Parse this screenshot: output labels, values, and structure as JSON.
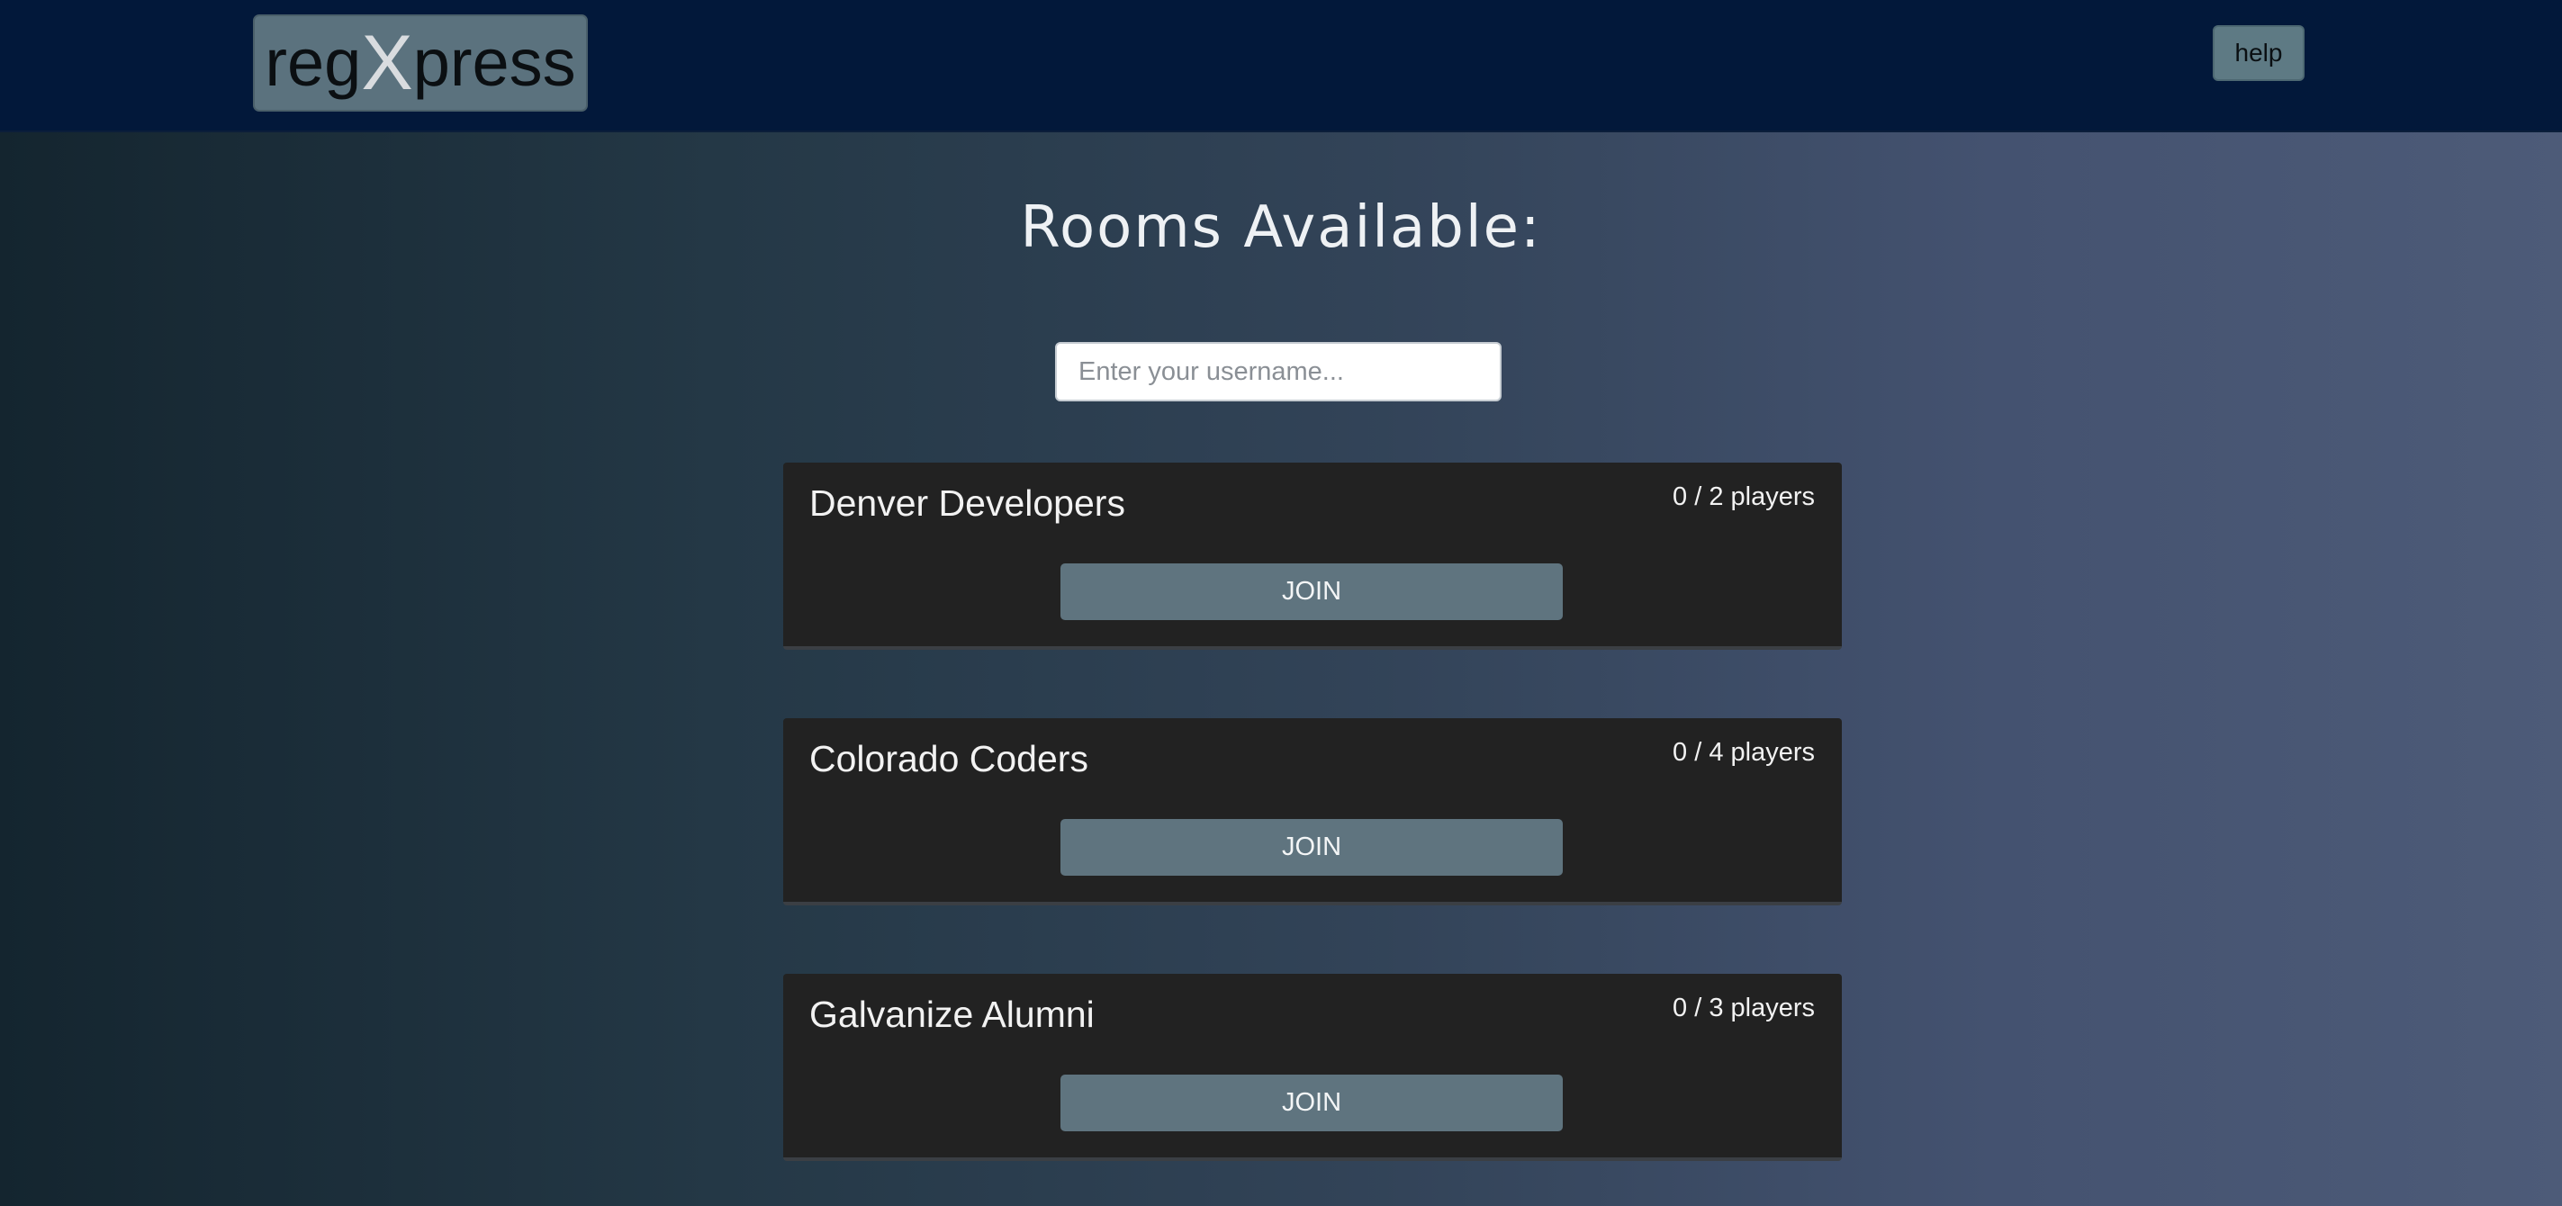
{
  "header": {
    "logo_prefix": "reg",
    "logo_x": "X",
    "logo_suffix": "press",
    "help_label": "help"
  },
  "main": {
    "title": "Rooms Available:",
    "username_placeholder": "Enter your username...",
    "rooms": [
      {
        "name": "Denver Developers",
        "players": "0 / 2 players",
        "join_label": "JOIN"
      },
      {
        "name": "Colorado Coders",
        "players": "0 / 4 players",
        "join_label": "JOIN"
      },
      {
        "name": "Galvanize Alumni",
        "players": "0 / 3 players",
        "join_label": "JOIN"
      }
    ]
  }
}
